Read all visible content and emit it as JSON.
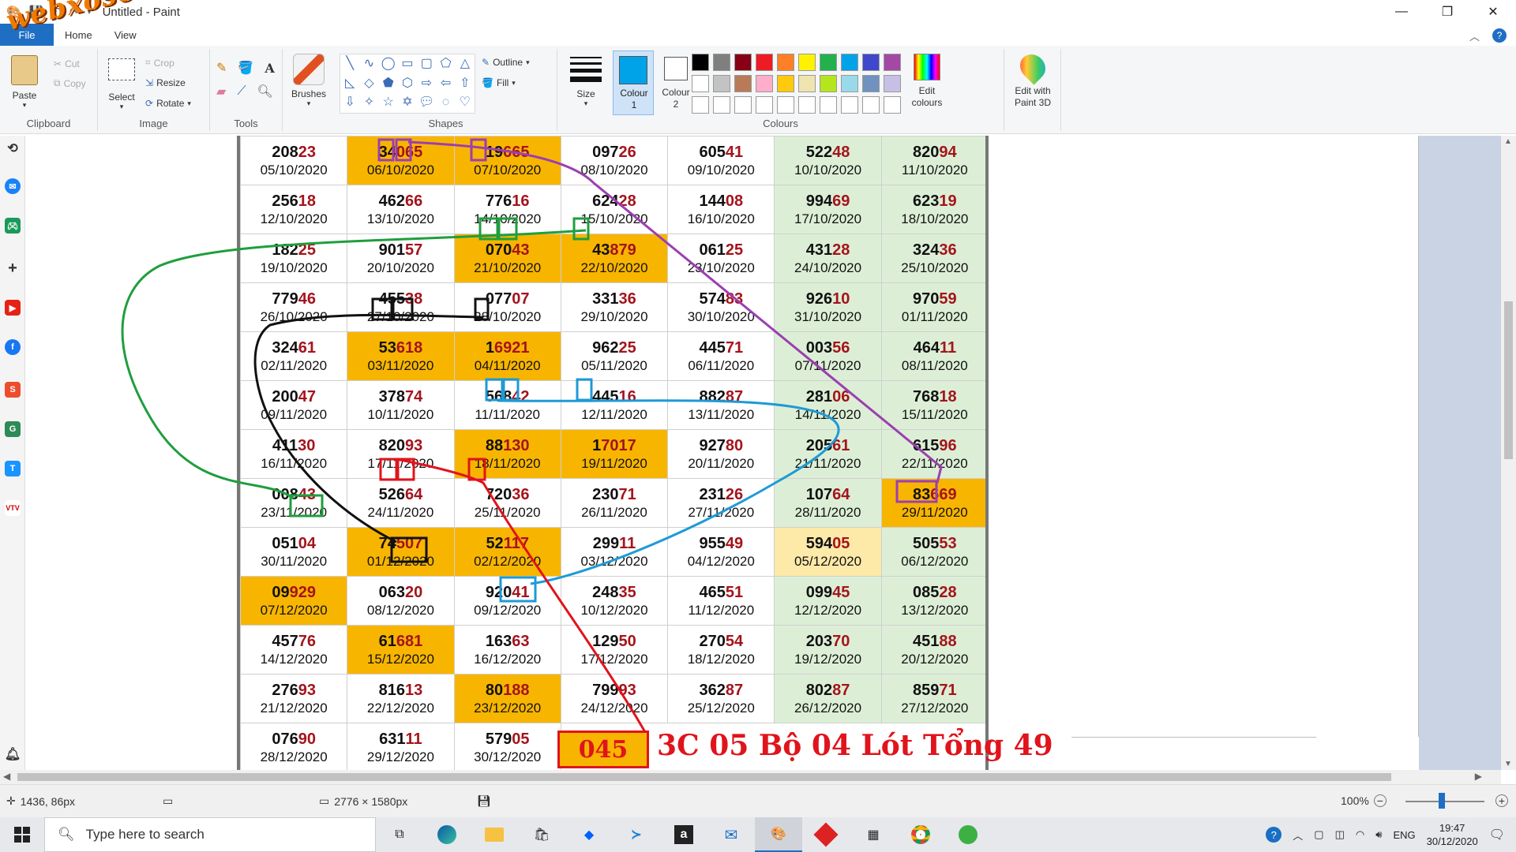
{
  "app": {
    "title": "Untitled - Paint",
    "watermark": "webxoso.net"
  },
  "menu": {
    "file": "File",
    "tabs": [
      "Home",
      "View"
    ]
  },
  "ribbon": {
    "clipboard": {
      "label": "Clipboard",
      "paste": "Paste",
      "cut": "Cut",
      "copy": "Copy"
    },
    "image": {
      "label": "Image",
      "select": "Select",
      "crop": "Crop",
      "resize": "Resize",
      "rotate": "Rotate"
    },
    "tools": {
      "label": "Tools"
    },
    "brushes": "Brushes",
    "shapes": {
      "label": "Shapes",
      "outline": "Outline",
      "fill": "Fill"
    },
    "size": "Size",
    "colour1": "Colour 1",
    "colour2": "Colour 2",
    "colours_label": "Colours",
    "edit_colours": "Edit colours",
    "edit_paint3d": "Edit with Paint 3D",
    "palette_row1": [
      "#000000",
      "#7f7f7f",
      "#880015",
      "#ed1c24",
      "#ff7f27",
      "#fff200",
      "#22b14c",
      "#00a2e8",
      "#3f48cc",
      "#a349a4"
    ],
    "palette_row2": [
      "#ffffff",
      "#c3c3c3",
      "#b97a57",
      "#ffaec9",
      "#ffc90e",
      "#efe4b0",
      "#b5e61d",
      "#99d9ea",
      "#7092be",
      "#c8bfe7"
    ]
  },
  "table": {
    "rows": [
      [
        [
          "208",
          "23",
          "05/10/2020",
          ""
        ],
        [
          "34",
          "065",
          "06/10/2020",
          "hl"
        ],
        [
          "19",
          "665",
          "07/10/2020",
          "hl"
        ],
        [
          "097",
          "26",
          "08/10/2020",
          ""
        ],
        [
          "605",
          "41",
          "09/10/2020",
          ""
        ],
        [
          "522",
          "48",
          "10/10/2020",
          "g"
        ],
        [
          "820",
          "94",
          "11/10/2020",
          "g"
        ]
      ],
      [
        [
          "256",
          "18",
          "12/10/2020",
          ""
        ],
        [
          "462",
          "66",
          "13/10/2020",
          ""
        ],
        [
          "776",
          "16",
          "14/10/2020",
          ""
        ],
        [
          "624",
          "28",
          "15/10/2020",
          ""
        ],
        [
          "144",
          "08",
          "16/10/2020",
          ""
        ],
        [
          "994",
          "69",
          "17/10/2020",
          "g"
        ],
        [
          "623",
          "19",
          "18/10/2020",
          "g"
        ]
      ],
      [
        [
          "182",
          "25",
          "19/10/2020",
          ""
        ],
        [
          "901",
          "57",
          "20/10/2020",
          ""
        ],
        [
          "070",
          "43",
          "21/10/2020",
          "hl"
        ],
        [
          "43",
          "879",
          "22/10/2020",
          "hl"
        ],
        [
          "061",
          "25",
          "23/10/2020",
          ""
        ],
        [
          "431",
          "28",
          "24/10/2020",
          "g"
        ],
        [
          "324",
          "36",
          "25/10/2020",
          "g"
        ]
      ],
      [
        [
          "779",
          "46",
          "26/10/2020",
          ""
        ],
        [
          "455",
          "38",
          "27/10/2020",
          ""
        ],
        [
          "077",
          "07",
          "28/10/2020",
          ""
        ],
        [
          "331",
          "36",
          "29/10/2020",
          ""
        ],
        [
          "574",
          "83",
          "30/10/2020",
          ""
        ],
        [
          "926",
          "10",
          "31/10/2020",
          "g"
        ],
        [
          "970",
          "59",
          "01/11/2020",
          "g"
        ]
      ],
      [
        [
          "324",
          "61",
          "02/11/2020",
          ""
        ],
        [
          "53",
          "618",
          "03/11/2020",
          "hl"
        ],
        [
          "1",
          "6921",
          "04/11/2020",
          "hl"
        ],
        [
          "962",
          "25",
          "05/11/2020",
          ""
        ],
        [
          "445",
          "71",
          "06/11/2020",
          ""
        ],
        [
          "003",
          "56",
          "07/11/2020",
          "g"
        ],
        [
          "464",
          "11",
          "08/11/2020",
          "g"
        ]
      ],
      [
        [
          "200",
          "47",
          "09/11/2020",
          ""
        ],
        [
          "378",
          "74",
          "10/11/2020",
          ""
        ],
        [
          "568",
          "42",
          "11/11/2020",
          ""
        ],
        [
          "445",
          "16",
          "12/11/2020",
          ""
        ],
        [
          "882",
          "87",
          "13/11/2020",
          ""
        ],
        [
          "281",
          "06",
          "14/11/2020",
          "g"
        ],
        [
          "768",
          "18",
          "15/11/2020",
          "g"
        ]
      ],
      [
        [
          "411",
          "30",
          "16/11/2020",
          ""
        ],
        [
          "820",
          "93",
          "17/11/2020",
          ""
        ],
        [
          "88",
          "130",
          "18/11/2020",
          "hl"
        ],
        [
          "1",
          "7017",
          "19/11/2020",
          "hl"
        ],
        [
          "927",
          "80",
          "20/11/2020",
          ""
        ],
        [
          "205",
          "61",
          "21/11/2020",
          "g"
        ],
        [
          "615",
          "96",
          "22/11/2020",
          "g"
        ]
      ],
      [
        [
          "008",
          "43",
          "23/11/2020",
          ""
        ],
        [
          "526",
          "64",
          "24/11/2020",
          ""
        ],
        [
          "720",
          "36",
          "25/11/2020",
          ""
        ],
        [
          "230",
          "71",
          "26/11/2020",
          ""
        ],
        [
          "231",
          "26",
          "27/11/2020",
          ""
        ],
        [
          "107",
          "64",
          "28/11/2020",
          "g"
        ],
        [
          "83",
          "669",
          "29/11/2020",
          "hl"
        ]
      ],
      [
        [
          "051",
          "04",
          "30/11/2020",
          ""
        ],
        [
          "74",
          "507",
          "01/12/2020",
          "hl"
        ],
        [
          "52",
          "117",
          "02/12/2020",
          "hl"
        ],
        [
          "299",
          "11",
          "03/12/2020",
          ""
        ],
        [
          "955",
          "49",
          "04/12/2020",
          ""
        ],
        [
          "594",
          "05",
          "05/12/2020",
          "y"
        ],
        [
          "505",
          "53",
          "06/12/2020",
          "g"
        ]
      ],
      [
        [
          "09",
          "929",
          "07/12/2020",
          "hl"
        ],
        [
          "063",
          "20",
          "08/12/2020",
          ""
        ],
        [
          "920",
          "41",
          "09/12/2020",
          ""
        ],
        [
          "248",
          "35",
          "10/12/2020",
          ""
        ],
        [
          "465",
          "51",
          "11/12/2020",
          ""
        ],
        [
          "099",
          "45",
          "12/12/2020",
          "g"
        ],
        [
          "085",
          "28",
          "13/12/2020",
          "g"
        ]
      ],
      [
        [
          "457",
          "76",
          "14/12/2020",
          ""
        ],
        [
          "61",
          "681",
          "15/12/2020",
          "hl"
        ],
        [
          "163",
          "63",
          "16/12/2020",
          ""
        ],
        [
          "129",
          "50",
          "17/12/2020",
          ""
        ],
        [
          "270",
          "54",
          "18/12/2020",
          ""
        ],
        [
          "203",
          "70",
          "19/12/2020",
          "g"
        ],
        [
          "451",
          "88",
          "20/12/2020",
          "g"
        ]
      ],
      [
        [
          "276",
          "93",
          "21/12/2020",
          ""
        ],
        [
          "816",
          "13",
          "22/12/2020",
          ""
        ],
        [
          "80",
          "188",
          "23/12/2020",
          "hl"
        ],
        [
          "799",
          "93",
          "24/12/2020",
          ""
        ],
        [
          "362",
          "87",
          "25/12/2020",
          ""
        ],
        [
          "802",
          "87",
          "26/12/2020",
          "g"
        ],
        [
          "859",
          "71",
          "27/12/2020",
          "g"
        ]
      ],
      [
        [
          "076",
          "90",
          "28/12/2020",
          ""
        ],
        [
          "631",
          "11",
          "29/12/2020",
          ""
        ],
        [
          "579",
          "05",
          "30/12/2020",
          ""
        ]
      ]
    ],
    "result_number": "045",
    "result_text": "3C 05 Bộ 04 Lót Tổng 49"
  },
  "status": {
    "cursor": "1436, 86px",
    "image_size": "2776 × 1580px",
    "zoom": "100%"
  },
  "taskbar": {
    "search_placeholder": "Type here to search",
    "lang": "ENG",
    "time": "19:47",
    "date": "30/12/2020"
  }
}
